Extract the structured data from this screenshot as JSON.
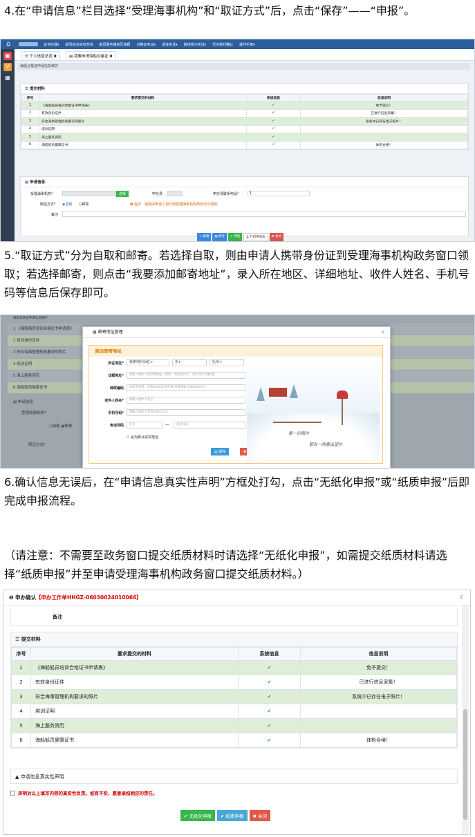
{
  "step4": {
    "text": "4.在“申请信息”栏目选择“受理海事机构”和“取证方式”后，点击“保存”——“申报”。"
  },
  "step5": {
    "text": "5.“取证方式”分为自取和邮寄。若选择自取，则由申请人携带身份证到受理海事机构政务窗口领取；若选择邮寄，则点击“我要添加邮寄地址”，录入所在地区、详细地址、收件人姓名、手机号码等信息后保存即可。"
  },
  "step6": {
    "text": "6.确认信息无误后，在“申请信息真实性声明”方框处打勾，点击“无纸化申报”或“纸质申报”后即完成申报流程。"
  },
  "note": {
    "text": "（请注意：不需要至政务窗口提交纸质材料时请选择“无纸化申报”，如需提交纸质材料请选择“纸质申报”并至申请受理海事机构政务窗口提交纸质材料。）"
  },
  "shot1": {
    "nav": [
      "证书办理▾",
      "船员综合信息查询",
      "船员服务簿资历填报",
      "合格证考试▾",
      "适任考试▾",
      "航线签注考试▾",
      "代办委托确认",
      "操作手册▾"
    ],
    "tab1": "☰ 个人信息总览 ✖",
    "tab2": "▤ 我要申请海船合格证 ✖",
    "breadcrumb": "海船合格证申请信息维护",
    "materials_title": "☰ 提交材料",
    "headers": [
      "序号",
      "要求提交的材料",
      "系统信息",
      "信息说明"
    ],
    "rows": [
      [
        "1",
        "《海船船员培训合格证书申请表》",
        "✔",
        "免予提交！"
      ],
      [
        "2",
        "有效身份证件",
        "✔",
        "已进行信息采集！"
      ],
      [
        "3",
        "符合海事管理机构要求的照片",
        "✔",
        "系统中已存在电子照片！"
      ],
      [
        "4",
        "培训证明",
        "✔",
        ""
      ],
      [
        "5",
        "海上服务资历",
        "✔",
        ""
      ],
      [
        "6",
        "海船船员健康证书",
        "✔",
        "体检合格！"
      ]
    ],
    "apply_title": "▤ 申请信息",
    "agency_label": "受理海事机构*",
    "select_btn": "选择",
    "handler_label": "申办员",
    "phone_label": "申办员联系电话*",
    "phone_value": "1",
    "method_label": "取证方式*",
    "self": "自取",
    "mail": "邮寄",
    "tip": "❶ 提示：自取由申请人自行到受理海事机构政务大厅领取。",
    "remark_label": "备注",
    "buttons": [
      "+ 新增",
      "▤ 保存",
      "✔ 申报",
      "⎙ 打印申请表",
      "✖ 关闭"
    ]
  },
  "shot2": {
    "bg_breadcrumb": "海船合格证申请信息维护",
    "bg_rows": [
      "1    《海船船员培训合格证书申请表》",
      "2    有效身份证件",
      "3    符合海事管理机构要求的照片",
      "4    培训证明",
      "5    海上服务资历",
      "6    海船船员健康证书"
    ],
    "bg_apply": "▤ 申请信息",
    "bg_agency": "受理海事机构*",
    "bg_method": "取证方式*",
    "bg_radio": "○自取 ◉邮寄",
    "modal_title": "▤ 邮寄地址管理",
    "close": "X",
    "inner_title": "添加邮寄地址",
    "labels": [
      "所在地区*",
      "详细地址*",
      "邮政编码",
      "收件人姓名*",
      "手机号码*",
      "电话号码"
    ],
    "region": [
      "香港特别行政区",
      "市",
      "区/县"
    ],
    "address_ph": "请输入收件人的详细地址，例如：XX街道X号，X栋X单元X楼X室",
    "zip_ph": "如您不清楚，可填000000或不填(系统将默认填000000)",
    "name_ph": "请输入收件人姓名",
    "mobile_ph": "请输入收件人手机号码(11位)",
    "area_ph": "区号",
    "tel_ph": "电话号码",
    "default_label": "设为默认收货地址",
    "save": "▤ 保存",
    "cancel": "✖ 取消",
    "poem1": "寄一份期许",
    "poem2": "都有一场喜出望外"
  },
  "shot3": {
    "title": "❶ 申办确认",
    "order": "【申办工作单HHGZ-06030024010066】",
    "close": "X",
    "remark": "备注",
    "materials_title": "☰ 提交材料",
    "headers": [
      "序号",
      "要求提交的材料",
      "系统信息",
      "信息说明"
    ],
    "rows": [
      [
        "1",
        "《海船船员培训合格证书申请表》",
        "✔",
        "免予提交！"
      ],
      [
        "2",
        "有效身份证件",
        "✔",
        "已进行信息采集！"
      ],
      [
        "3",
        "符合海事管理机构要求的照片",
        "✔",
        "系统中已存在电子照片！"
      ],
      [
        "4",
        "培训证明",
        "✔",
        ""
      ],
      [
        "5",
        "海上服务资历",
        "✔",
        ""
      ],
      [
        "6",
        "海船船员健康证书",
        "✔",
        "体检合格！"
      ]
    ],
    "decl_title": "▲ 申请信息真实性声明",
    "decl": "声明对以上填写内容的真实性负责。如有不实，愿意承担相应的责任。",
    "buttons": [
      "✔ 无纸化申报",
      "✔ 纸质申报",
      "✖ 关闭"
    ]
  }
}
